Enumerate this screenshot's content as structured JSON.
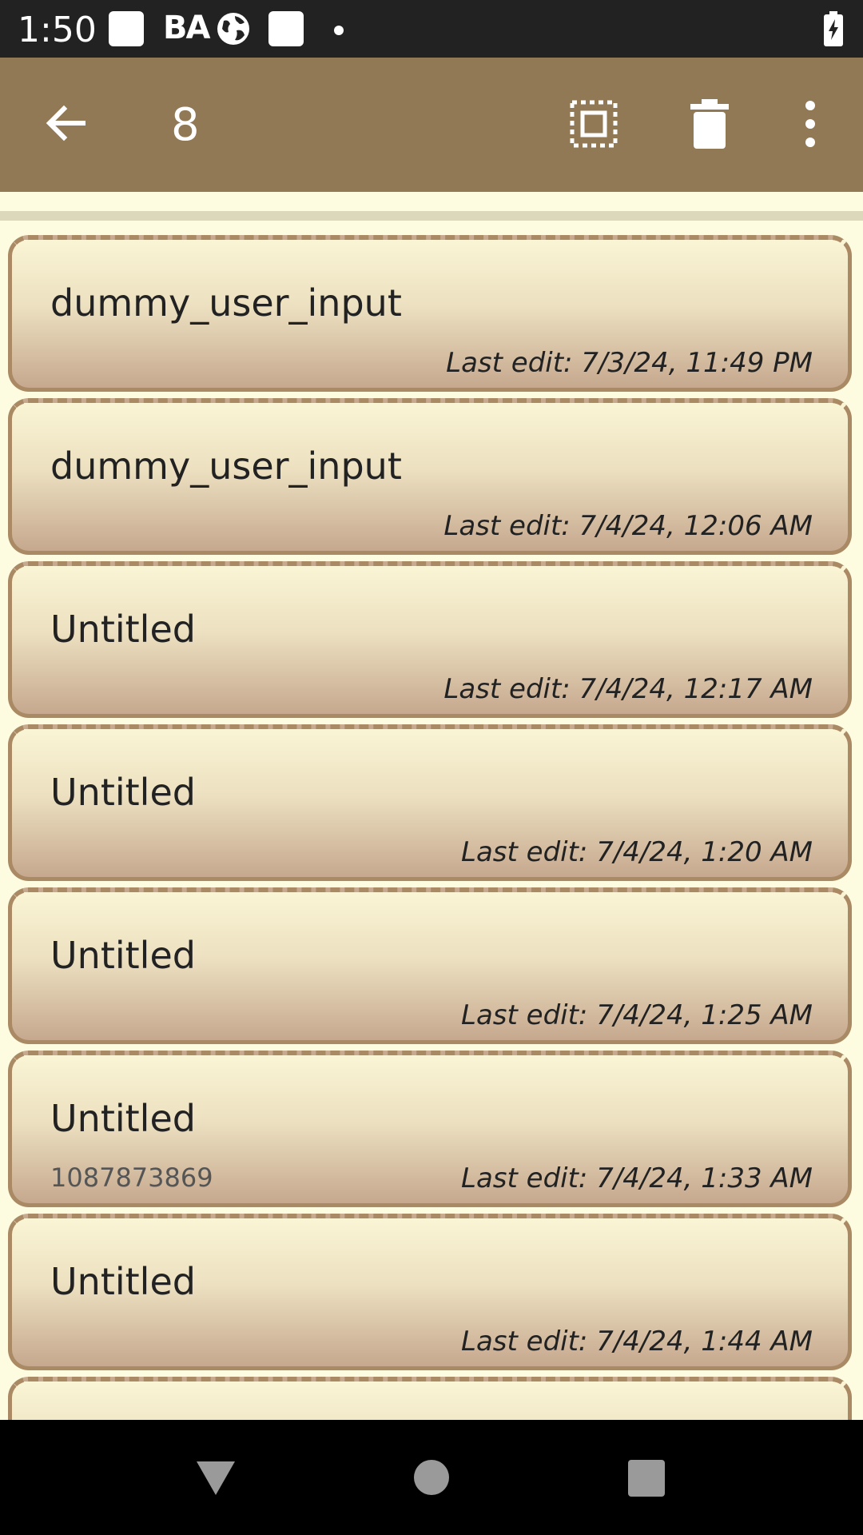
{
  "status_bar": {
    "time": "1:50",
    "icons": [
      "square-icon",
      "ba-icon",
      "globe-icon",
      "square-icon",
      "dot-icon",
      "battery-charging-icon"
    ],
    "ba_text": "BA"
  },
  "toolbar": {
    "selected_count": "8",
    "icons": [
      "back-arrow-icon",
      "select-all-icon",
      "trash-icon",
      "more-vert-icon"
    ],
    "background": "#927956"
  },
  "notes": [
    {
      "title": "dummy_user_input",
      "subtitle": "",
      "last_edit": "Last edit: 7/3/24, 11:49 PM"
    },
    {
      "title": "dummy_user_input",
      "subtitle": "",
      "last_edit": "Last edit: 7/4/24, 12:06 AM"
    },
    {
      "title": "Untitled",
      "subtitle": "",
      "last_edit": "Last edit: 7/4/24, 12:17 AM"
    },
    {
      "title": "Untitled",
      "subtitle": "",
      "last_edit": "Last edit: 7/4/24, 1:20 AM"
    },
    {
      "title": "Untitled",
      "subtitle": "",
      "last_edit": "Last edit: 7/4/24, 1:25 AM"
    },
    {
      "title": "Untitled",
      "subtitle": "1087873869",
      "last_edit": "Last edit: 7/4/24, 1:33 AM"
    },
    {
      "title": "Untitled",
      "subtitle": "",
      "last_edit": "Last edit: 7/4/24, 1:44 AM"
    },
    {
      "title": "",
      "subtitle": "",
      "last_edit": ""
    }
  ],
  "nav_bar": {
    "icons": [
      "nav-back-icon",
      "nav-home-icon",
      "nav-recents-icon"
    ]
  },
  "colors": {
    "accent": "#927956",
    "background": "#fdfbe0",
    "card_border": "#a98a64"
  }
}
